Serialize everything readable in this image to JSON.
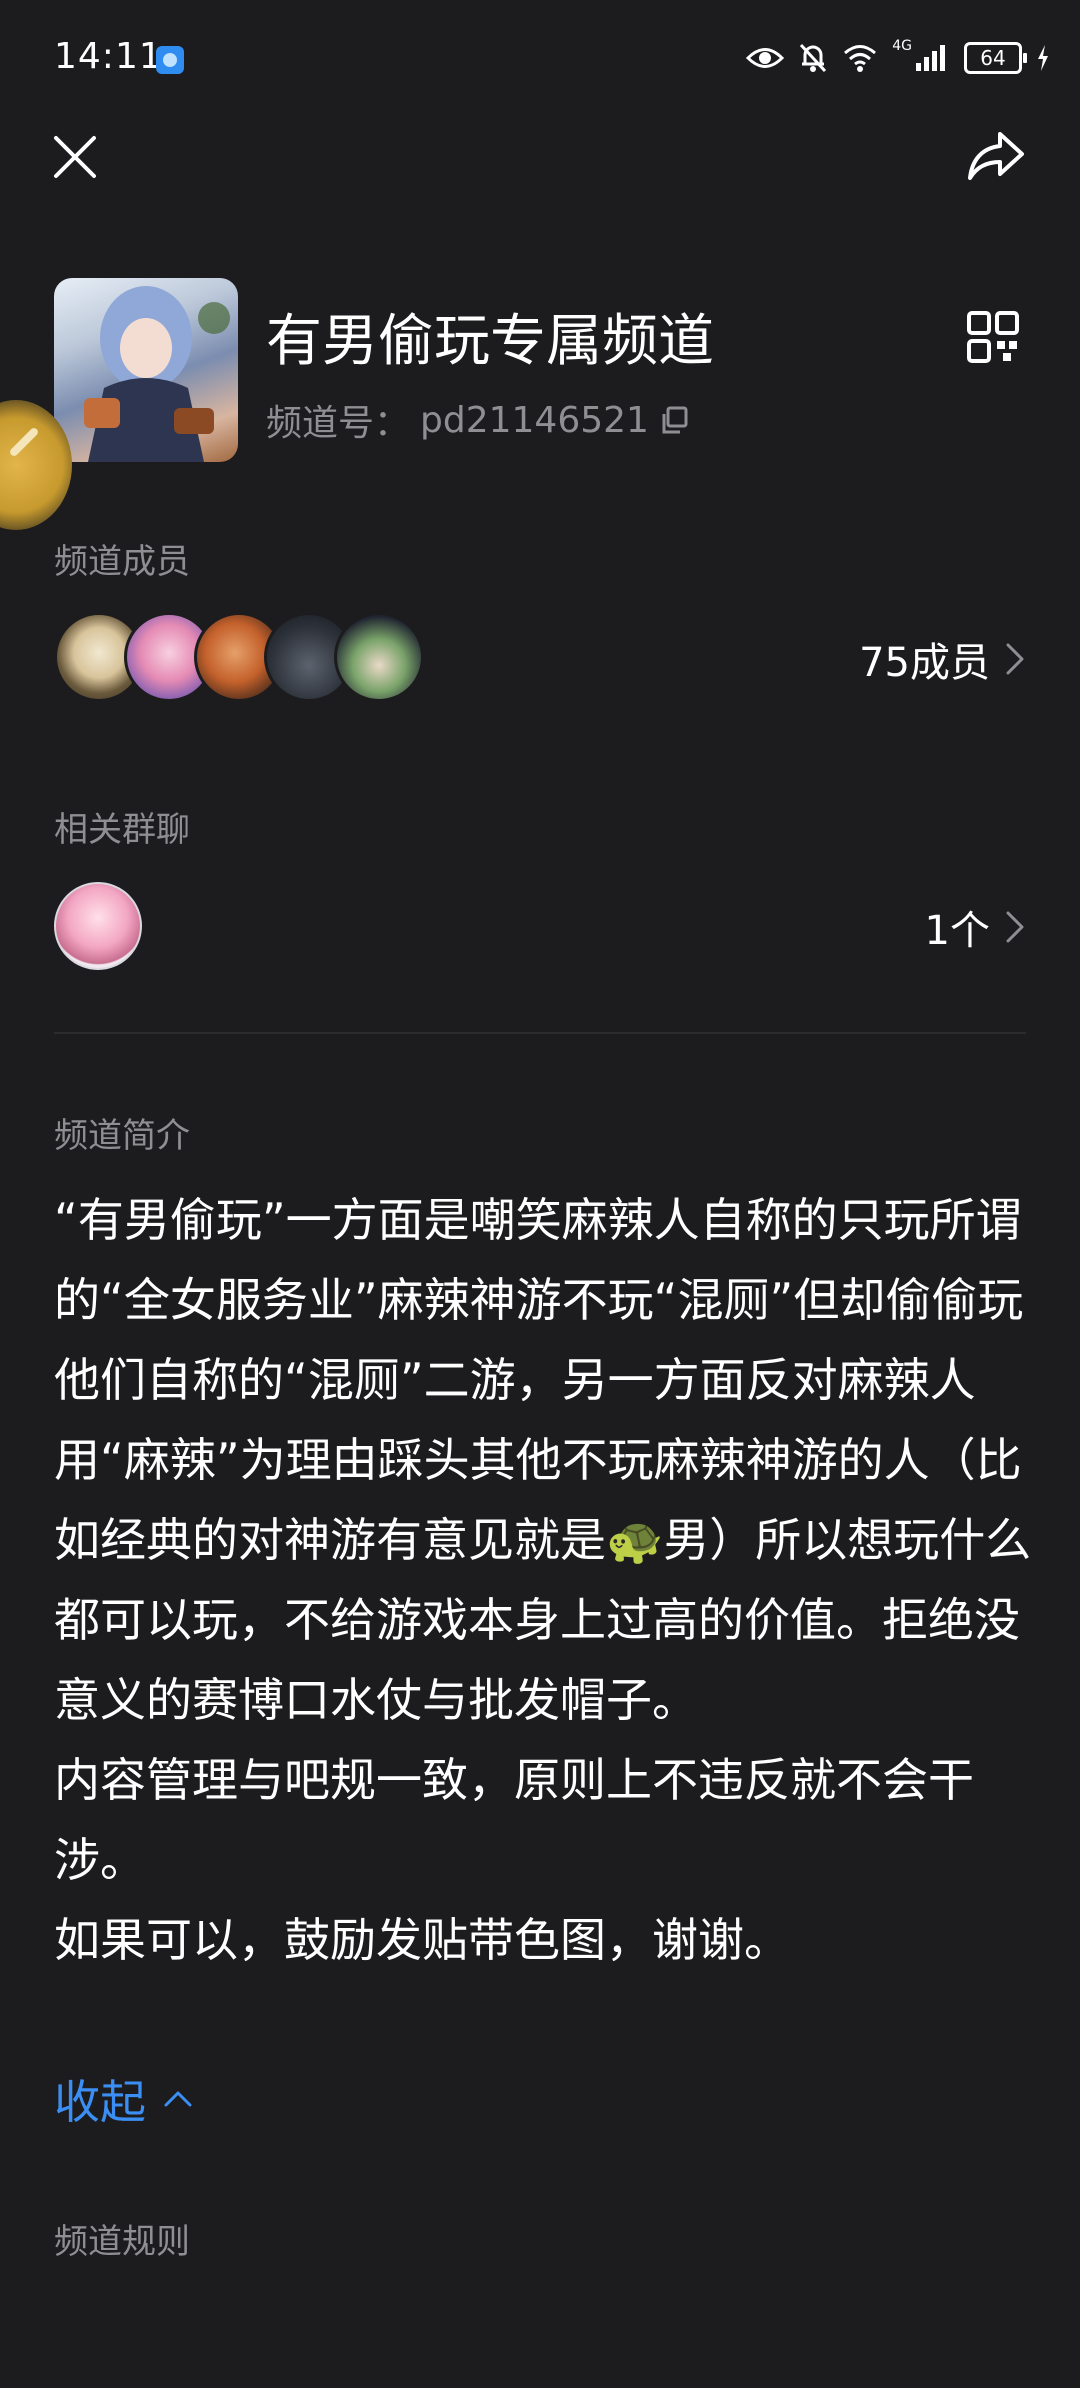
{
  "status_bar": {
    "time": "14:11",
    "battery": "64",
    "network": "4G",
    "icons": [
      "eye-icon",
      "bell-muted-icon",
      "wifi-icon",
      "signal-icon",
      "battery-icon",
      "charging-icon"
    ]
  },
  "header": {
    "close_icon": "close-icon",
    "share_icon": "share-icon"
  },
  "channel": {
    "title": "有男偷玩专属频道",
    "id_label": "频道号：",
    "id_value": "pd21146521",
    "qr_icon": "qr-code-icon",
    "copy_icon": "copy-icon"
  },
  "members": {
    "label": "频道成员",
    "count": "75成员",
    "avatars": [
      "avatar-1",
      "avatar-2",
      "avatar-3",
      "avatar-4",
      "avatar-5"
    ]
  },
  "groups": {
    "label": "相关群聊",
    "count": "1个"
  },
  "intro": {
    "label": "频道简介",
    "paragraphs": [
      "“有男偷玩”一方面是嘲笑麻辣人自称的只玩所谓的“全女服务业”麻辣神游不玩“混厕”但却偷偷玩他们自称的“混厕”二游，另一方面反对麻辣人用“麻辣”为理由踩头其他不玩麻辣神游的人（比如经典的对神游有意见就是🐢男）所以想玩什么都可以玩，不给游戏本身上过高的价值。拒绝没意义的赛博口水仗与批发帽子。",
      "内容管理与吧规一致，原则上不违反就不会干涉。",
      "如果可以，鼓励发贴带色图，谢谢。"
    ],
    "collapse_label": "收起"
  },
  "rules": {
    "label": "频道规则"
  },
  "colors": {
    "background": "#1c1c1e",
    "secondary_text": "#8e8e93",
    "link": "#3b8ef3"
  }
}
